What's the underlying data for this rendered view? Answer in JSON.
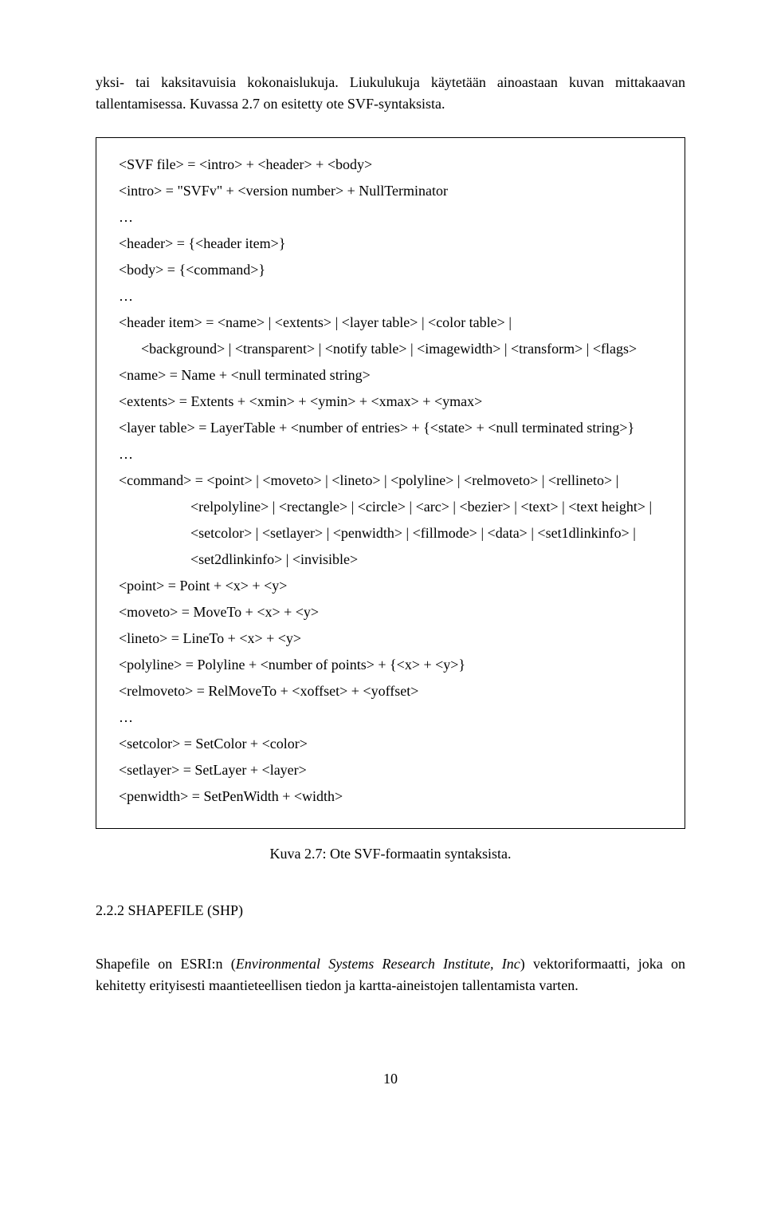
{
  "intro_para": "yksi- tai kaksitavuisia kokonaislukuja. Liukulukuja käytetään ainoastaan kuvan mittakaavan tallentamisessa. Kuvassa 2.7 on esitetty ote SVF-syntaksista.",
  "code": {
    "l1": "<SVF file> = <intro> + <header> + <body>",
    "l2": "<intro> = \"SVFv\" + <version number> + NullTerminator",
    "l3": "…",
    "l4": "<header> = {<header item>}",
    "l5": "<body> = {<command>}",
    "l6": "…",
    "l7": "<header item> = <name> | <extents> | <layer table> | <color table> |",
    "l8": "<background> | <transparent> | <notify table> | <imagewidth> | <transform> | <flags>",
    "l9": "<name> = Name + <null terminated string>",
    "l10": "<extents> = Extents + <xmin> + <ymin> + <xmax> + <ymax>",
    "l11": "<layer table> = LayerTable + <number of entries> + {<state> + <null terminated string>}",
    "l12": "…",
    "l13": "<command> = <point> | <moveto> | <lineto> | <polyline> | <relmoveto> | <rellineto> |",
    "l14": "<relpolyline> | <rectangle> | <circle> | <arc> | <bezier> | <text> | <text height> |",
    "l15": "<setcolor> | <setlayer> | <penwidth> | <fillmode> | <data> | <set1dlinkinfo> |",
    "l16": "<set2dlinkinfo> | <invisible>",
    "l17": "<point> = Point + <x> + <y>",
    "l18": "<moveto> = MoveTo + <x> + <y>",
    "l19": "<lineto> = LineTo + <x> + <y>",
    "l20": "<polyline> = Polyline + <number of points> + {<x> + <y>}",
    "l21": "<relmoveto> = RelMoveTo + <xoffset> + <yoffset>",
    "l22": "…",
    "l23": "<setcolor> = SetColor + <color>",
    "l24": "<setlayer> = SetLayer + <layer>",
    "l25": "<penwidth> = SetPenWidth + <width>"
  },
  "caption": "Kuva 2.7: Ote SVF-formaatin syntaksista.",
  "section_heading": "2.2.2 SHAPEFILE (SHP)",
  "body_para_pre": "Shapefile on ESRI:n (",
  "body_para_italic": "Environmental Systems Research Institute, Inc",
  "body_para_post": ") vektoriformaatti, joka on kehitetty erityisesti maantieteellisen tiedon ja kartta-aineistojen tallentamista varten.",
  "page_number": "10"
}
